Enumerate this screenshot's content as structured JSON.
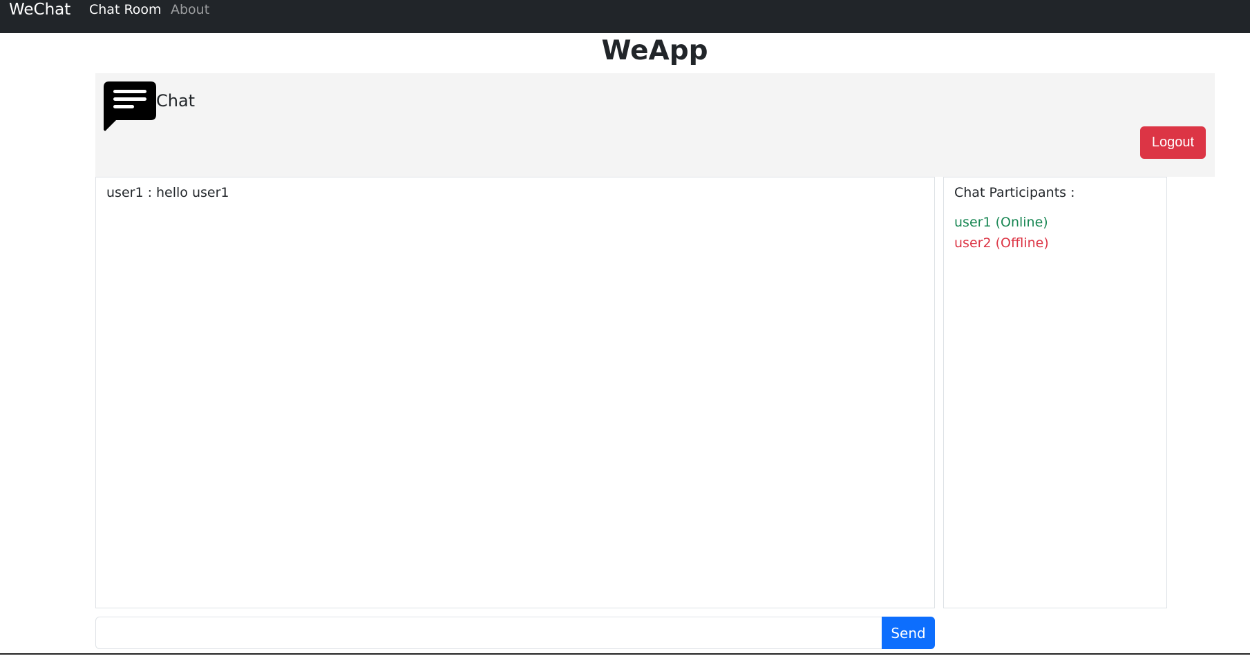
{
  "navbar": {
    "brand": "WeChat",
    "links": [
      {
        "label": "Chat Room",
        "active": true
      },
      {
        "label": "About",
        "active": false
      }
    ]
  },
  "app_title": "WeApp",
  "header": {
    "icon": "chat-bubble-icon",
    "label": "Chat",
    "logout_label": "Logout"
  },
  "messages": [
    {
      "text": "user1 : hello user1"
    }
  ],
  "participants": {
    "title": "Chat Participants :",
    "items": [
      {
        "label": "user1 (Online)",
        "status": "online",
        "color": "#198754"
      },
      {
        "label": "user2 (Offline)",
        "status": "offline",
        "color": "#dc3545"
      }
    ]
  },
  "composer": {
    "input_value": "",
    "send_label": "Send"
  },
  "colors": {
    "navbar": "#212529",
    "logout": "#dc3545",
    "send": "#0d6efd",
    "online": "#198754",
    "offline": "#dc3545"
  }
}
